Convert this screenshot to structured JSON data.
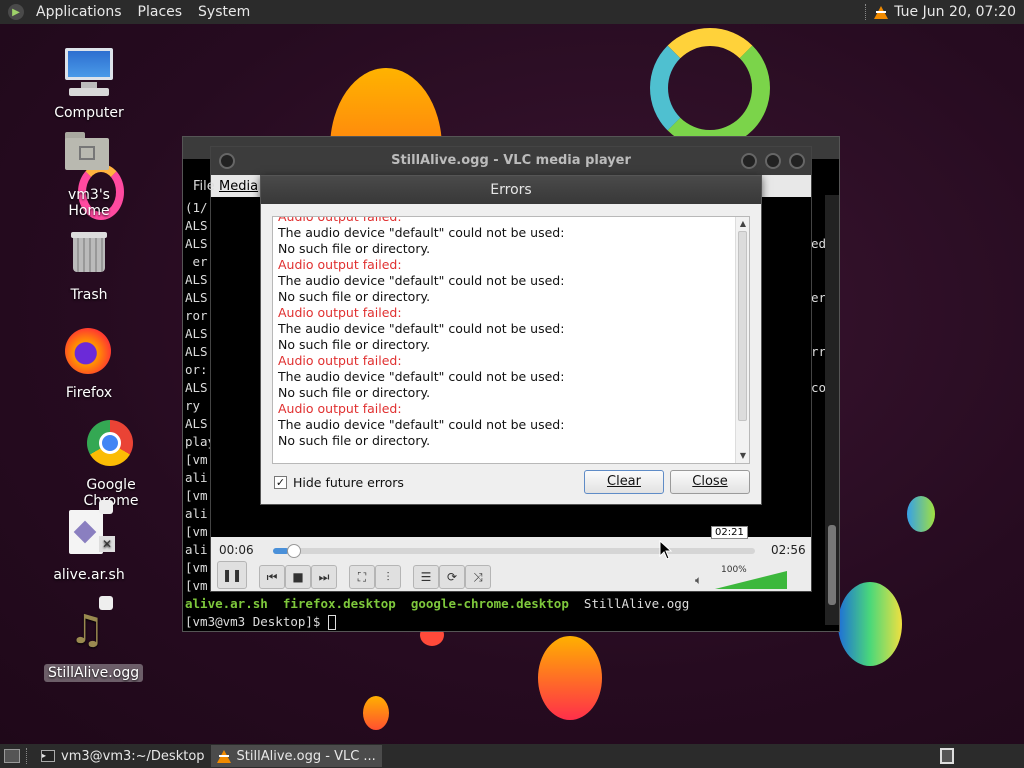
{
  "top_panel": {
    "menus": [
      "Applications",
      "Places",
      "System"
    ],
    "clock": "Tue Jun 20, 07:20"
  },
  "desktop_icons": [
    {
      "label": "Computer",
      "icon": "computer-icon"
    },
    {
      "label": "vm3's Home",
      "icon": "home-folder-icon"
    },
    {
      "label": "Trash",
      "icon": "trash-icon"
    },
    {
      "label": "Firefox",
      "icon": "firefox-icon"
    },
    {
      "label": "Google Chrome",
      "icon": "chrome-icon"
    },
    {
      "label": "alive.ar.sh",
      "icon": "script-file-icon"
    },
    {
      "label": "StillAlive.ogg",
      "icon": "audio-file-icon"
    }
  ],
  "terminal": {
    "left_lines": [
      "(1/",
      "ALS",
      "ALS",
      " er",
      "ALS",
      "ALS",
      "ror",
      "ALS",
      "ALS",
      "or:",
      "ALS",
      "ry",
      "ALS",
      "play",
      "[vm",
      "ali",
      "[vm",
      "ali",
      "[vm",
      "ali",
      "[vm",
      "[vm"
    ],
    "right_lines": [
      "ed",
      "",
      "",
      "er",
      "",
      "",
      "rr",
      "",
      "co"
    ],
    "listing": [
      "alive.ar.sh",
      "firefox.desktop",
      "google-chrome.desktop",
      "StillAlive.ogg"
    ],
    "prompt": "[vm3@vm3 Desktop]$ "
  },
  "vlc": {
    "title": "StillAlive.ogg - VLC media player",
    "menu": [
      "File",
      "Media"
    ],
    "elapsed": "00:06",
    "total": "02:56",
    "hover_time": "02:21",
    "progress": 0.034,
    "volume_label": "100%",
    "volume": 1.0
  },
  "errors_dialog": {
    "title": "Errors",
    "log": [
      {
        "text": "Audio output failed:",
        "type": "error"
      },
      {
        "text": "The audio device \"default\" could not be used:",
        "type": "info"
      },
      {
        "text": "No such file or directory.",
        "type": "info"
      },
      {
        "text": "Audio output failed:",
        "type": "error"
      },
      {
        "text": "The audio device \"default\" could not be used:",
        "type": "info"
      },
      {
        "text": "No such file or directory.",
        "type": "info"
      },
      {
        "text": "Audio output failed:",
        "type": "error"
      },
      {
        "text": "The audio device \"default\" could not be used:",
        "type": "info"
      },
      {
        "text": "No such file or directory.",
        "type": "info"
      },
      {
        "text": "Audio output failed:",
        "type": "error"
      },
      {
        "text": "The audio device \"default\" could not be used:",
        "type": "info"
      },
      {
        "text": "No such file or directory.",
        "type": "info"
      },
      {
        "text": "Audio output failed:",
        "type": "error"
      },
      {
        "text": "The audio device \"default\" could not be used:",
        "type": "info"
      },
      {
        "text": "No such file or directory.",
        "type": "info"
      }
    ],
    "hide_future_label": "Hide future errors",
    "hide_future_checked": true,
    "clear_label": "Clear",
    "close_label": "Close"
  },
  "bottom_panel": {
    "tasks": [
      {
        "label": "vm3@vm3:~/Desktop",
        "icon": "terminal-icon",
        "active": false
      },
      {
        "label": "StillAlive.ogg - VLC ...",
        "icon": "vlc-icon",
        "active": true
      }
    ]
  },
  "colors": {
    "error_text": "#e03030",
    "seek_fill": "#4a90d9",
    "volume_green": "#3cb83c",
    "terminal_green": "#7ec83c"
  }
}
